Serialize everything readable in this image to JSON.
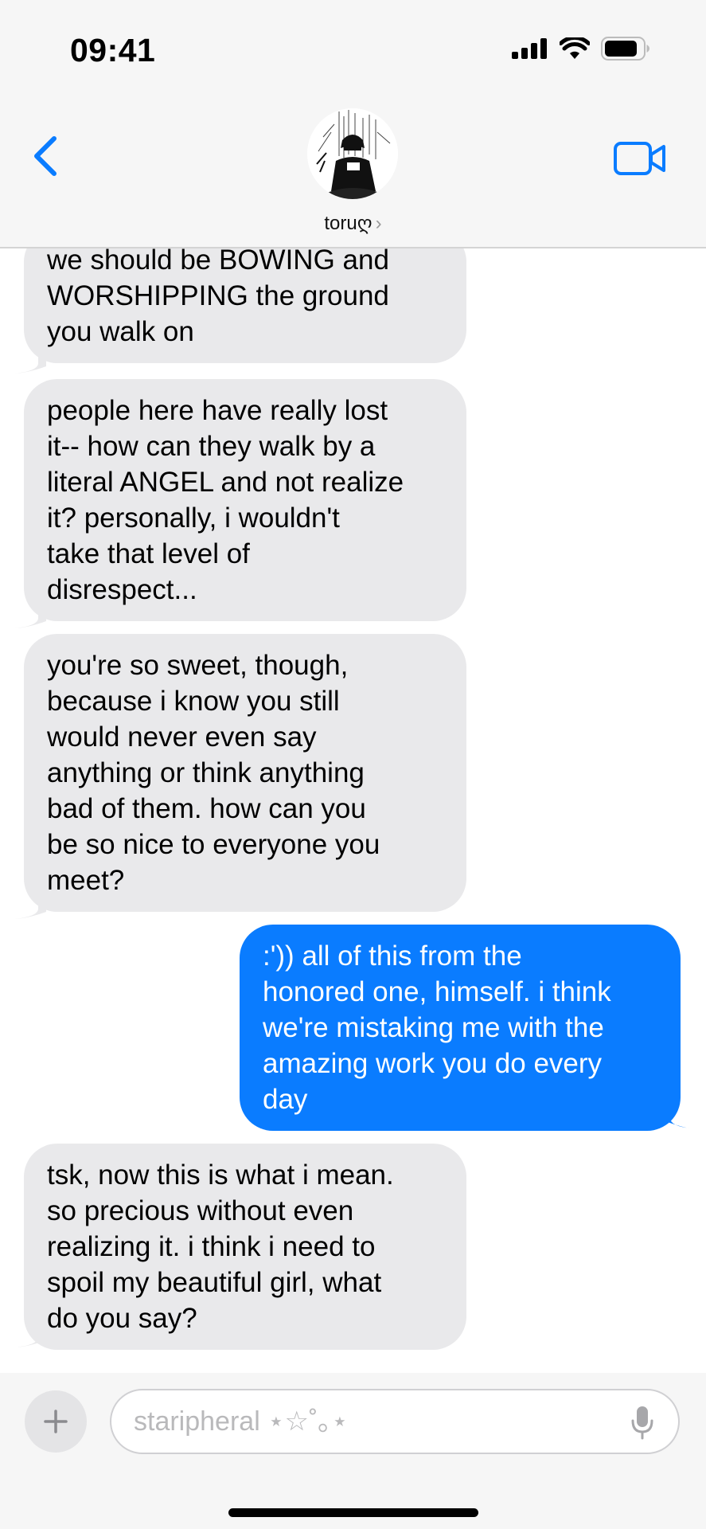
{
  "status_bar": {
    "time": "09:41"
  },
  "header": {
    "contact_name": "toruღ",
    "chevron": "›"
  },
  "messages": [
    {
      "direction": "incoming",
      "lines": [
        "we should be BOWING and",
        "WORSHIPPING the ground",
        "you walk on"
      ]
    },
    {
      "direction": "incoming",
      "lines": [
        "people here have really lost",
        "it-- how can they walk by a",
        "literal ANGEL and not realize",
        "it?  personally, i wouldn't",
        "take that level of",
        "disrespect..."
      ]
    },
    {
      "direction": "incoming",
      "lines": [
        "you're so sweet, though,",
        "because i know you still",
        "would never even say",
        "anything or think anything",
        "bad of them.  how can you",
        "be so nice to everyone you",
        "meet?"
      ]
    },
    {
      "direction": "outgoing",
      "lines": [
        ":')) all of this from the",
        "honored one, himself.  i think",
        "we're mistaking me with the",
        "amazing work you do every",
        "day"
      ]
    },
    {
      "direction": "incoming",
      "lines": [
        "tsk, now this is what i mean.",
        "so precious without even",
        "realizing it.  i think i need to",
        "spoil my beautiful girl, what",
        "do you say?"
      ]
    }
  ],
  "compose": {
    "placeholder": "staripheral ⋆☆˚｡⋆",
    "value": ""
  },
  "icons": {
    "back": "chevron-left-icon",
    "video": "video-camera-icon",
    "plus": "plus-icon",
    "mic": "microphone-icon",
    "signal": "cellular-signal-icon",
    "wifi": "wifi-icon",
    "battery": "battery-icon"
  },
  "colors": {
    "accent": "#0a7cff",
    "incoming_bubble": "#e9e9eb",
    "header_bg": "#f6f6f6"
  }
}
